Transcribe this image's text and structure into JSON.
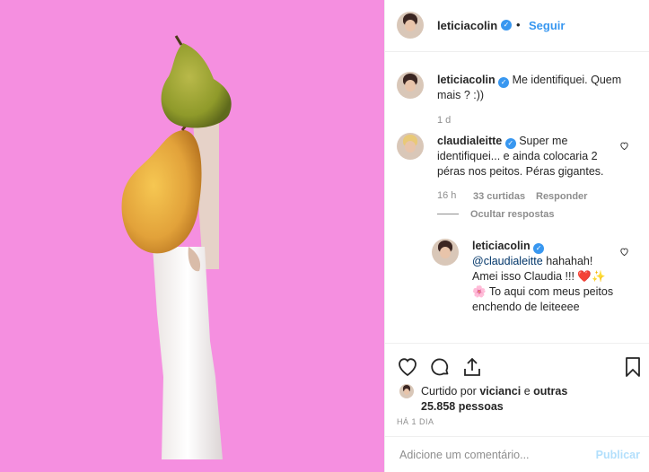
{
  "header": {
    "username": "leticiacolin",
    "separator": "•",
    "follow_label": "Seguir"
  },
  "caption": {
    "username": "leticiacolin",
    "text": "Me identifiquei. Quem mais ? :))",
    "time": "1 d"
  },
  "comment1": {
    "username": "claudialeitte",
    "text": "Super me identifiquei... e ainda colocaria 2 péras nos peitos. Péras gigantes.",
    "time": "16 h",
    "likes": "33 curtidas",
    "reply_label": "Responder",
    "hide_replies": "Ocultar respostas"
  },
  "reply1": {
    "username": "leticiacolin",
    "mention": "@claudialeitte",
    "text1": "hahahah! Amei isso Claudia !!!",
    "emoji1": "❤️✨",
    "emoji2": "🌸",
    "text2": "To aqui com meus peitos enchendo de leiteeee"
  },
  "likes": {
    "prefix": "Curtido por",
    "user": "vicianci",
    "middle": "e",
    "others": "outras 25.858 pessoas"
  },
  "timestamp": "HÁ 1 DIA",
  "add_comment": {
    "placeholder": "Adicione um comentário...",
    "publish_label": "Publicar"
  },
  "colors": {
    "photo_bg": "#f58fe0",
    "accent": "#3897f0",
    "publish_disabled": "#b2dffc"
  }
}
